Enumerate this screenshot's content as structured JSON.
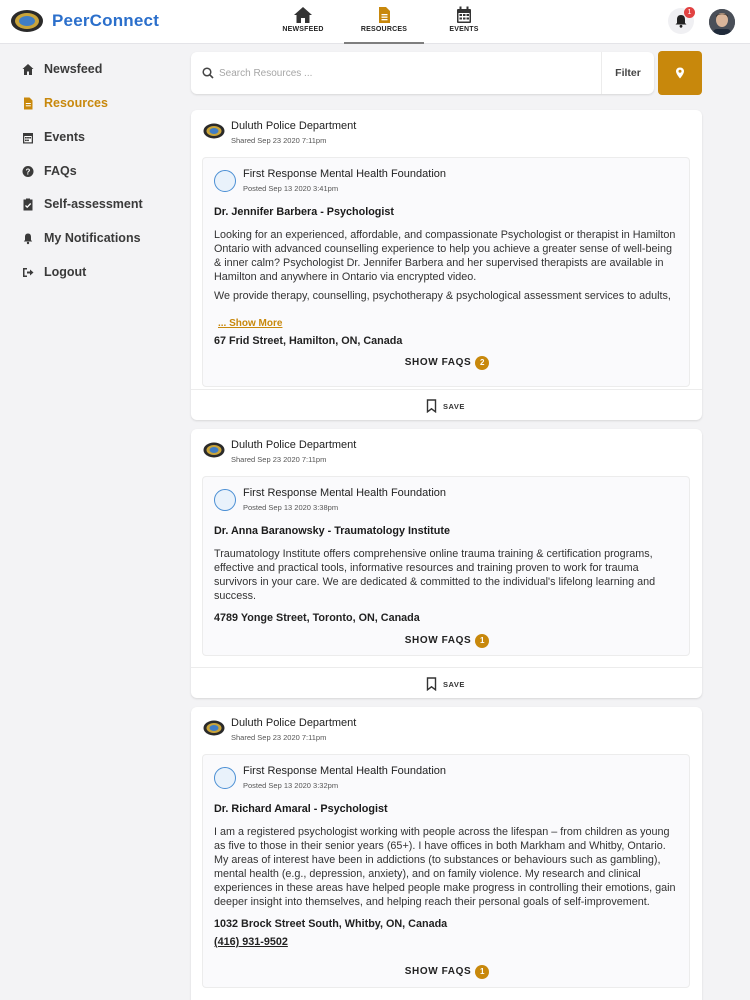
{
  "app": {
    "brand": "PeerConnect",
    "notification_count": "1"
  },
  "topnav": [
    {
      "label": "NEWSFEED",
      "icon": "home-icon"
    },
    {
      "label": "RESOURCES",
      "icon": "document-icon"
    },
    {
      "label": "EVENTS",
      "icon": "calendar-icon"
    }
  ],
  "sidebar": {
    "items": [
      {
        "label": "Newsfeed",
        "icon": "home-icon"
      },
      {
        "label": "Resources",
        "icon": "document-icon"
      },
      {
        "label": "Events",
        "icon": "calendar-icon"
      },
      {
        "label": "FAQs",
        "icon": "question-icon"
      },
      {
        "label": "Self-assessment",
        "icon": "clipboard-icon"
      },
      {
        "label": "My Notifications",
        "icon": "bell-icon"
      },
      {
        "label": "Logout",
        "icon": "logout-icon"
      }
    ]
  },
  "search": {
    "placeholder": "Search Resources ...",
    "value": "",
    "filter_label": "Filter"
  },
  "colors": {
    "accent": "#c8880c",
    "brand": "#2b6fcb",
    "badge": "#e14242"
  },
  "cards": [
    {
      "shared_by": "Duluth Police Department",
      "shared_date": "Shared Sep 23 2020 7:11pm",
      "org": "First Response Mental Health Foundation",
      "posted_date": "Posted Sep 13 2020 3:41pm",
      "title": "Dr. Jennifer Barbera - Psychologist",
      "description": "Looking for an experienced, affordable, and compassionate Psychologist or therapist in Hamilton Ontario with advanced counselling experience to help you achieve a greater sense of well-being & inner calm? Psychologist Dr. Jennifer Barbera and her supervised therapists are available in Hamilton and anywhere in Ontario via encrypted video.",
      "description2": "We provide therapy, counselling, psychotherapy & psychological assessment services to adults,",
      "show_more": "... Show More",
      "address": "67 Frid Street, Hamilton, ON, Canada",
      "faq_label": "SHOW FAQS",
      "faq_count": "2",
      "save_label": "SAVE"
    },
    {
      "shared_by": "Duluth Police Department",
      "shared_date": "Shared Sep 23 2020 7:11pm",
      "org": "First Response Mental Health Foundation",
      "posted_date": "Posted Sep 13 2020 3:38pm",
      "title": "Dr. Anna Baranowsky - Traumatology Institute",
      "description": "Traumatology Institute offers comprehensive online trauma training & certification programs, effective and practical tools, informative resources and training proven to work for trauma survivors in your care. We are dedicated & committed to the individual's lifelong learning and success.",
      "address": "4789 Yonge Street, Toronto, ON, Canada",
      "faq_label": "SHOW FAQS",
      "faq_count": "1",
      "save_label": "SAVE"
    },
    {
      "shared_by": "Duluth Police Department",
      "shared_date": "Shared Sep 23 2020 7:11pm",
      "org": "First Response Mental Health Foundation",
      "posted_date": "Posted Sep 13 2020 3:32pm",
      "title": "Dr. Richard Amaral - Psychologist",
      "description": "I am a registered psychologist working with people across the lifespan – from children as young as five to those in their senior years (65+). I have offices in both Markham and Whitby, Ontario. My areas of interest have been in addictions (to substances or behaviours such as gambling), mental health (e.g., depression, anxiety), and on family violence. My research and clinical experiences in these areas have helped people make progress in controlling their emotions, gain deeper insight into themselves, and helping reach their personal goals of self-improvement.",
      "address": "1032 Brock Street South, Whitby, ON, Canada",
      "phone": "(416) 931-9502",
      "faq_label": "SHOW FAQS",
      "faq_count": "1"
    }
  ]
}
